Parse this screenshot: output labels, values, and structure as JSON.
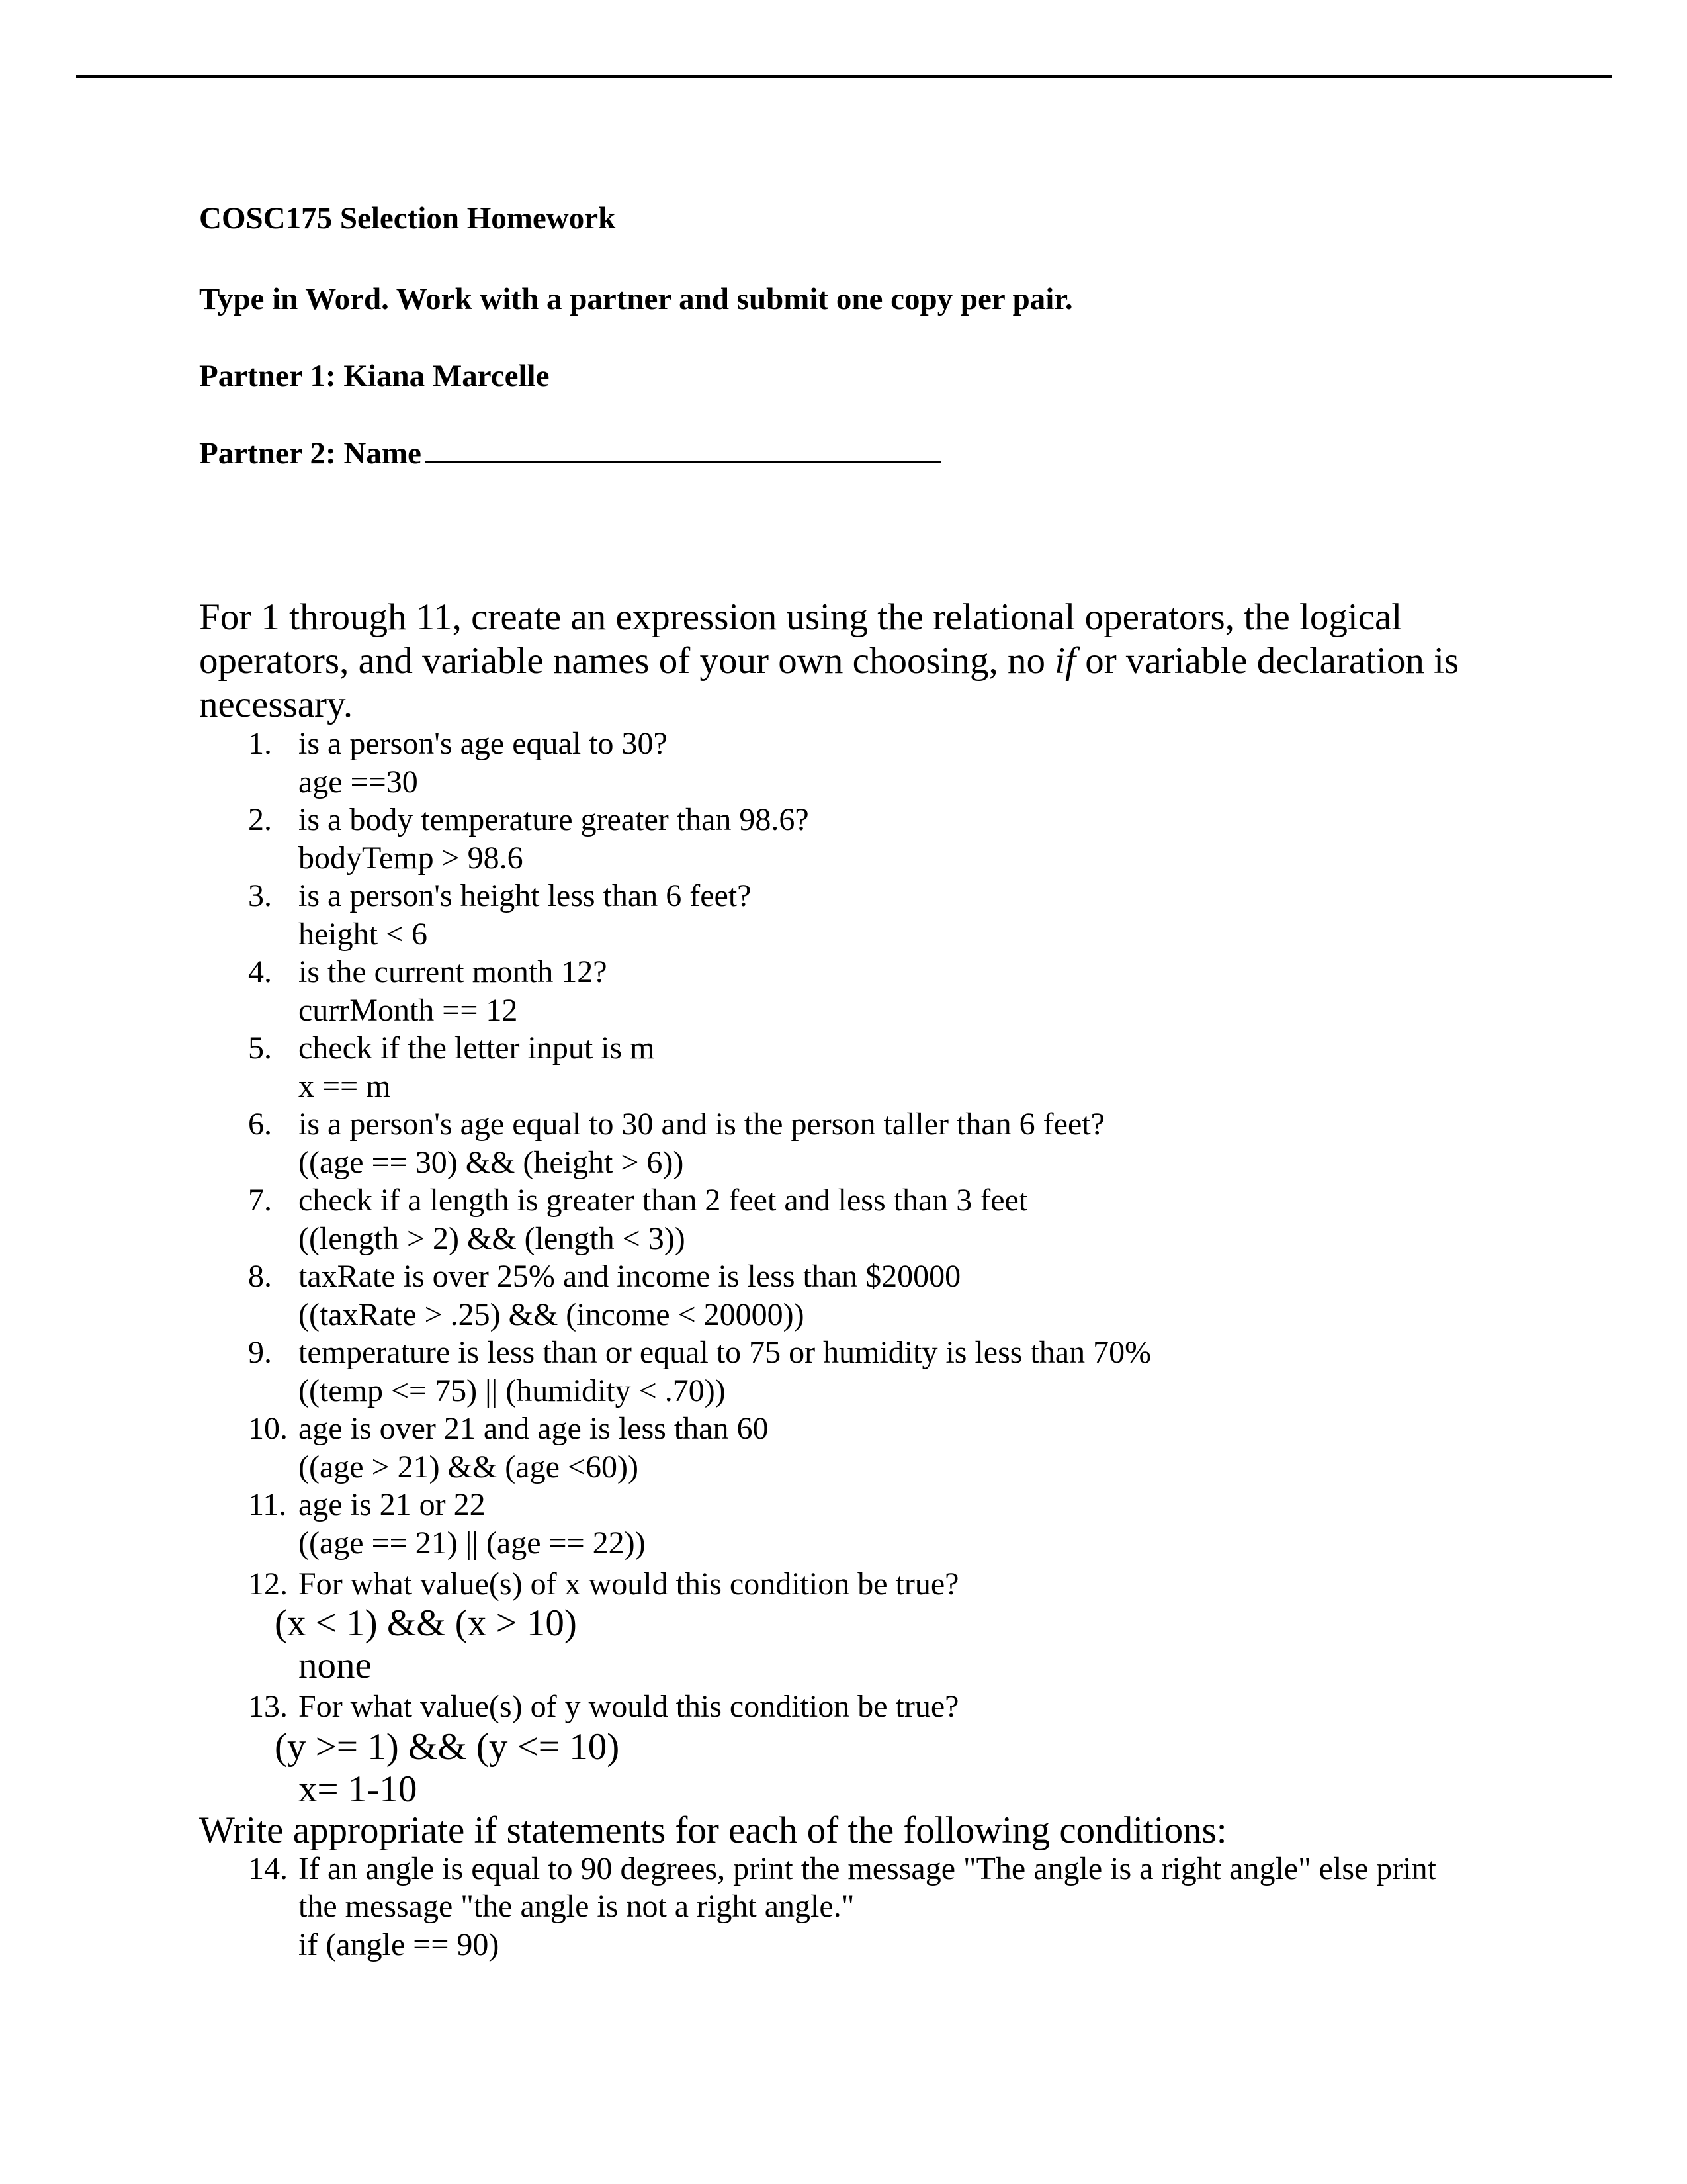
{
  "document": {
    "title": "COSC175 Selection Homework",
    "instructions": "Type in Word. Work with a partner and submit one copy per pair.",
    "partner1": "Partner 1: Kiana Marcelle",
    "partner2_label": "Partner 2: Name",
    "intro": {
      "before_italic": "For 1 through 11, create an expression using the relational operators, the logical operators, and variable names of your own choosing, no ",
      "italic": "if",
      "after_italic": " or variable declaration is necessary."
    },
    "questions": [
      {
        "number": "1.",
        "prompt": "is a person's age equal to 30?",
        "answer": "age ==30"
      },
      {
        "number": "2.",
        "prompt": "is a body temperature  greater than 98.6?",
        "answer": "bodyTemp > 98.6"
      },
      {
        "number": "3.",
        "prompt": "is a person's height less than 6 feet?",
        "answer": "height < 6"
      },
      {
        "number": "4.",
        "prompt": "is the current month 12?",
        "answer": "currMonth == 12"
      },
      {
        "number": "5.",
        "prompt": "check if the letter input is m",
        "answer": "x == m"
      },
      {
        "number": "6.",
        "prompt": "is a person's age equal to 30 and is the person taller than 6 feet?",
        "answer": "((age == 30) && (height > 6))"
      },
      {
        "number": "7.",
        "prompt": "check if a length is greater than 2 feet and less than 3 feet",
        "answer": "((length > 2) && (length < 3))"
      },
      {
        "number": "8.",
        "prompt": "taxRate is over 25% and income is less than $20000",
        "answer": "((taxRate > .25) && (income < 20000))"
      },
      {
        "number": "9.",
        "prompt": "temperature is less than or equal to 75 or humidity is less than 70%",
        "answer": "((temp <= 75) || (humidity < .70))"
      },
      {
        "number": "10.",
        "prompt": "age is over 21 and age is less than 60",
        "answer": "((age > 21) && (age <60))"
      },
      {
        "number": "11.",
        "prompt": "age is 21 or 22",
        "answer": "((age == 21) || (age == 22))"
      },
      {
        "number": "12.",
        "prompt": "For what value(s) of x would this condition be true?",
        "expression": "(x < 1) && (x > 10)",
        "answer": "none"
      },
      {
        "number": "13.",
        "prompt": "For what value(s) of y would this condition be true?",
        "expression": "(y >= 1) && (y <= 10)",
        "answer": "x= 1-10"
      }
    ],
    "section2_heading": "Write appropriate if statements for each of the following conditions:",
    "question14": {
      "number": "14.",
      "prompt_line1": "If an angle is equal to 90 degrees, print the message \"The angle is a right angle\" else print",
      "prompt_line2": "the message \"the angle is not a right angle.\"",
      "answer": "if (angle == 90)"
    }
  }
}
